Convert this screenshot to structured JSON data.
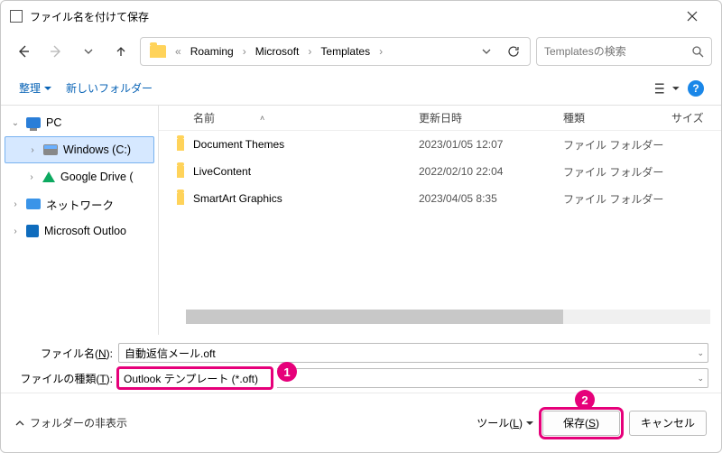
{
  "window": {
    "title": "ファイル名を付けて保存"
  },
  "breadcrumb": {
    "parts": [
      "Roaming",
      "Microsoft",
      "Templates"
    ],
    "search_placeholder": "Templatesの検索"
  },
  "toolbar": {
    "organize": "整理",
    "new_folder": "新しいフォルダー"
  },
  "tree": {
    "pc": "PC",
    "c_drive": "Windows (C:)",
    "gdrive": "Google Drive (",
    "network": "ネットワーク",
    "outlook": "Microsoft Outloo"
  },
  "columns": {
    "name": "名前",
    "date": "更新日時",
    "type": "種類",
    "size": "サイズ"
  },
  "files": [
    {
      "name": "Document Themes",
      "date": "2023/01/05 12:07",
      "type": "ファイル フォルダー"
    },
    {
      "name": "LiveContent",
      "date": "2022/02/10 22:04",
      "type": "ファイル フォルダー"
    },
    {
      "name": "SmartArt Graphics",
      "date": "2023/04/05 8:35",
      "type": "ファイル フォルダー"
    }
  ],
  "form": {
    "filename_label_pre": "ファイル名(",
    "filename_label_u": "N",
    "filename_label_post": "):",
    "filename_value": "自動返信メール.oft",
    "filetype_label_pre": "ファイルの種類(",
    "filetype_label_u": "T",
    "filetype_label_post": "):",
    "filetype_value": "Outlook テンプレート (*.oft)"
  },
  "footer": {
    "hide_folders": "フォルダーの非表示",
    "tools_pre": "ツール(",
    "tools_u": "L",
    "tools_post": ")",
    "save_pre": "保存(",
    "save_u": "S",
    "save_post": ")",
    "cancel": "キャンセル"
  },
  "annotations": {
    "one": "1",
    "two": "2"
  }
}
